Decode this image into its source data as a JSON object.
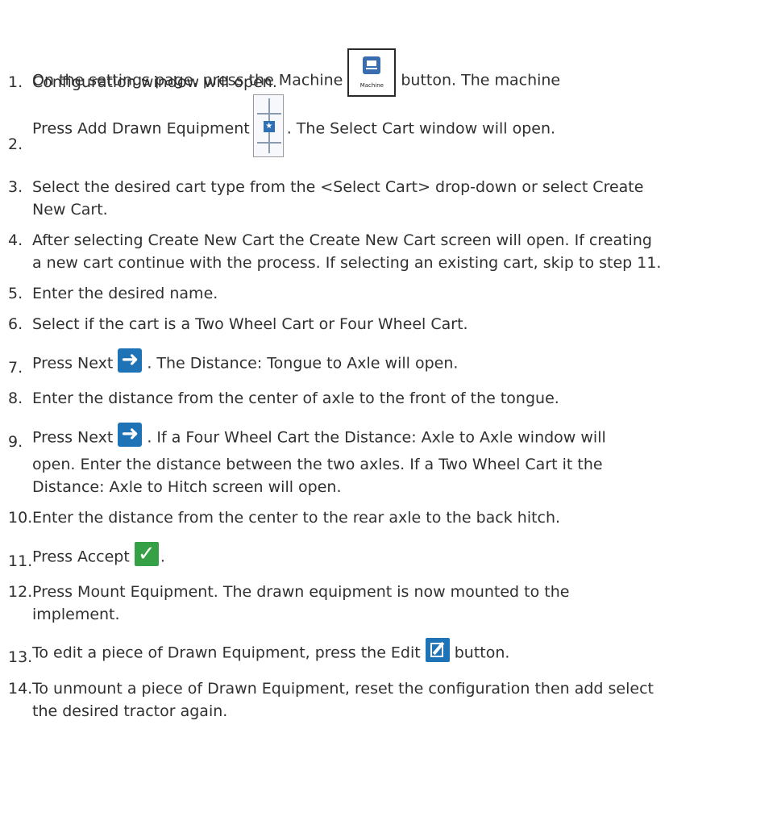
{
  "steps": [
    {
      "num": "1.",
      "pre": "On the settings page, press the Machine",
      "post": "button. The machine",
      "line2": "Configuration window will open.",
      "icon_label": "Machine"
    },
    {
      "num": "2.",
      "pre": "Press Add Drawn Equipment",
      "post": ". The Select Cart window will open."
    },
    {
      "num": "3.",
      "line1": "Select the desired cart type from the <Select Cart> drop-down or select Create",
      "line2": "New Cart."
    },
    {
      "num": "4.",
      "line1": "After selecting Create New Cart the Create New Cart screen will open. If creating",
      "line2": "a new cart continue with the process. If selecting an existing cart, skip to step 11."
    },
    {
      "num": "5.",
      "line1": "Enter the desired name."
    },
    {
      "num": "6.",
      "line1": "Select if the cart is a Two Wheel Cart or Four Wheel Cart."
    },
    {
      "num": "7.",
      "pre": "Press Next",
      "post": ". The Distance: Tongue to Axle will open."
    },
    {
      "num": "8.",
      "line1": "Enter the distance from the center of axle to the front of the tongue."
    },
    {
      "num": "9.",
      "pre": "Press Next",
      "post": ". If a Four Wheel Cart the Distance: Axle to Axle window will",
      "line2": "open. Enter the distance between the two axles. If a Two Wheel Cart it the",
      "line3": "Distance: Axle to Hitch screen will open."
    },
    {
      "num": "10.",
      "line1": "Enter the distance from the center to the rear axle to the back hitch."
    },
    {
      "num": "11.",
      "pre": "Press Accept",
      "post": "."
    },
    {
      "num": "12.",
      "line1": "Press Mount Equipment. The drawn equipment is now mounted to the",
      "line2": "implement."
    },
    {
      "num": "13.",
      "pre": "To edit a piece of Drawn Equipment, press the Edit",
      "post": "button."
    },
    {
      "num": "14.",
      "line1": "To unmount a piece of Drawn Equipment, reset the configuration then add select",
      "line2": "the desired tractor again."
    }
  ],
  "icons": {
    "machine": "tractor-icon",
    "drawn": "drawn-equipment-icon",
    "next": "right-arrow-icon",
    "accept": "checkmark-icon",
    "edit": "edit-icon"
  },
  "colors": {
    "text": "#303030",
    "blue": "#1d73b6",
    "green": "#36a046"
  }
}
